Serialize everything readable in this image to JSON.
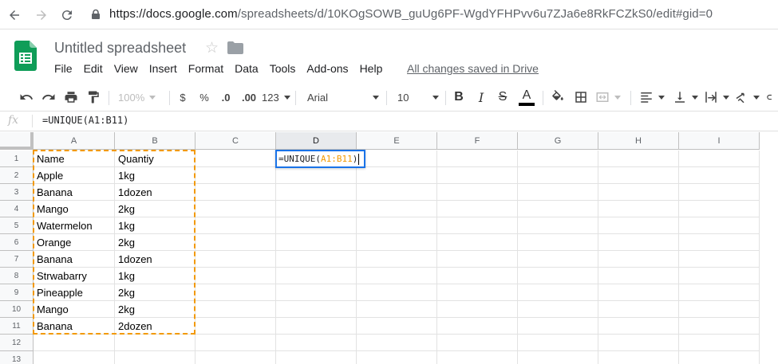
{
  "browser": {
    "url_host": "https://docs.google.com",
    "url_path": "/spreadsheets/d/10KOgSOWB_guUg6PF-WgdYFHPvv6u7ZJa6e8RkFCZkS0/edit#gid=0"
  },
  "header": {
    "title": "Untitled spreadsheet",
    "saved_status": "All changes saved in Drive",
    "menu": [
      "File",
      "Edit",
      "View",
      "Insert",
      "Format",
      "Data",
      "Tools",
      "Add-ons",
      "Help"
    ]
  },
  "toolbar": {
    "zoom": "100%",
    "currency": "$",
    "percent": "%",
    "decrease_decimal": ".0",
    "increase_decimal": ".00",
    "more_formats": "123",
    "font": "Arial",
    "font_size": "10",
    "bold": "B",
    "italic": "I",
    "strike": "S",
    "text_color": "A"
  },
  "formula_bar": {
    "fx_label": "fx",
    "formula": "=UNIQUE(A1:B11)"
  },
  "sheet": {
    "columns": [
      "A",
      "B",
      "C",
      "D",
      "E",
      "F",
      "G",
      "H",
      "I"
    ],
    "rows": [
      "1",
      "2",
      "3",
      "4",
      "5",
      "6",
      "7",
      "8",
      "9",
      "10",
      "11",
      "12",
      "13"
    ],
    "data": [
      [
        "Name",
        "Quantiy"
      ],
      [
        "Apple",
        "1kg"
      ],
      [
        "Banana",
        "1dozen"
      ],
      [
        "Mango",
        "2kg"
      ],
      [
        "Watermelon",
        "1kg"
      ],
      [
        "Orange",
        "2kg"
      ],
      [
        "Banana",
        "1dozen"
      ],
      [
        "Strwabarry",
        "1kg"
      ],
      [
        "Pineapple",
        "2kg"
      ],
      [
        "Mango",
        "2kg"
      ],
      [
        "Banana",
        "2dozen"
      ]
    ],
    "active_cell": "D1",
    "editor": {
      "prefix": "=UNIQUE(",
      "range": "A1:B11",
      "suffix": ")"
    }
  },
  "colors": {
    "accent_blue": "#1a73e8",
    "range_orange": "#f29900",
    "sheets_green": "#0f9d58"
  }
}
